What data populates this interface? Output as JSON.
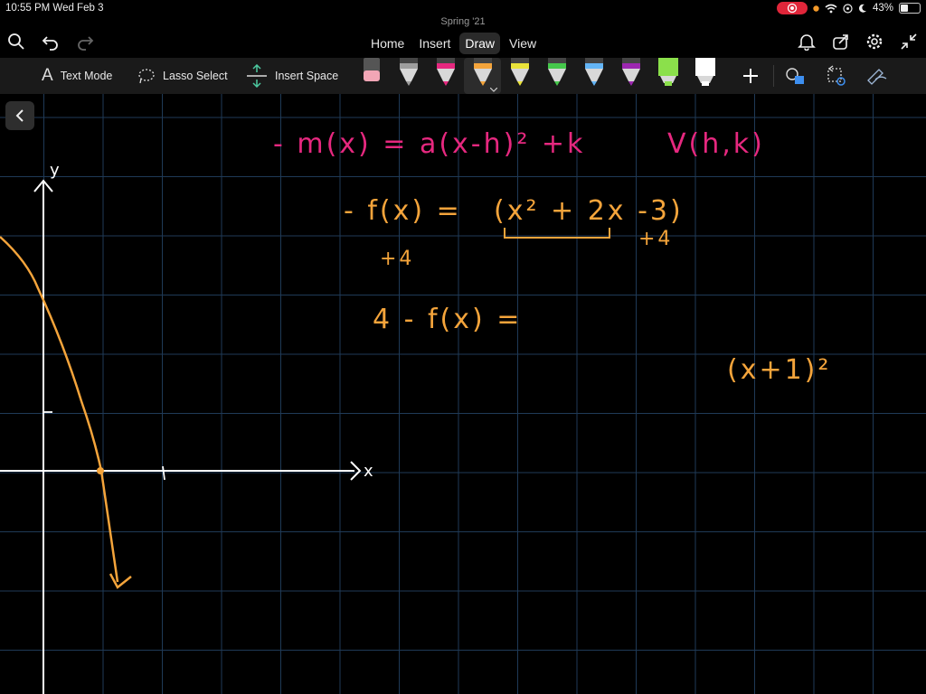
{
  "status": {
    "time_date": "10:55 PM   Wed Feb 3",
    "battery_percent": "43%",
    "battery_level": 0.43
  },
  "document": {
    "title": "Spring '21"
  },
  "tabs": [
    {
      "label": "Home"
    },
    {
      "label": "Insert"
    },
    {
      "label": "Draw",
      "active": true
    },
    {
      "label": "View"
    }
  ],
  "toolbar": {
    "text_mode_label": "Text Mode",
    "lasso_label": "Lasso Select",
    "insert_space_label": "Insert Space",
    "pens": [
      {
        "name": "eraser",
        "color": "#f2a6b6"
      },
      {
        "name": "pen-gray",
        "color": "#9e9e9e"
      },
      {
        "name": "pen-pink",
        "color": "#e6287f"
      },
      {
        "name": "pen-orange",
        "color": "#f4a43b",
        "selected": true
      },
      {
        "name": "pen-yellow",
        "color": "#e9e33a"
      },
      {
        "name": "pen-green",
        "color": "#45c84b"
      },
      {
        "name": "pen-blue",
        "color": "#64b5f6"
      },
      {
        "name": "pen-purple",
        "color": "#9c27b0"
      },
      {
        "name": "highlighter-green",
        "color": "#8be04b"
      },
      {
        "name": "highlighter-white",
        "color": "#ffffff"
      }
    ]
  },
  "notes": {
    "vertex_form": "- m(x) = a(x-h)² +k",
    "vertex": "V(h,k)",
    "f_eq_left": "- f(x) =",
    "f_eq_right": "(x² + 2x  -3)",
    "plus4_left": "+4",
    "plus4_right": "+4",
    "four_minus": "4 - f(x) =",
    "square": "(x+1)²",
    "axis_x": "x",
    "axis_y": "y"
  },
  "colors": {
    "pink_ink": "#e6287f",
    "orange_ink": "#f4a43b",
    "grid": "#1f3a57"
  }
}
